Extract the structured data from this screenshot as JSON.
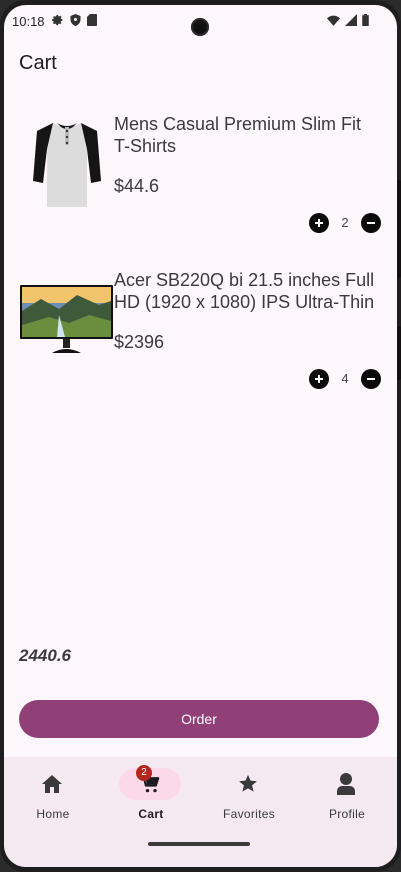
{
  "status_bar": {
    "time": "10:18"
  },
  "page": {
    "title": "Cart"
  },
  "cart": {
    "items": [
      {
        "name": "Mens Casual Premium Slim Fit T-Shirts",
        "price": "$44.6",
        "quantity": "2"
      },
      {
        "name": "Acer SB220Q bi 21.5 inches Full HD (1920 x 1080) IPS Ultra-Thin",
        "price": "$2396",
        "quantity": "4"
      }
    ],
    "total": "2440.6",
    "order_label": "Order"
  },
  "nav": {
    "items": [
      {
        "label": "Home",
        "icon": "home-icon"
      },
      {
        "label": "Cart",
        "icon": "cart-icon",
        "badge": "2",
        "active": true
      },
      {
        "label": "Favorites",
        "icon": "star-icon"
      },
      {
        "label": "Profile",
        "icon": "person-icon"
      }
    ]
  },
  "colors": {
    "accent": "#914077",
    "nav_bg": "#f5e9f1",
    "active_pill": "#fcd9ea",
    "badge": "#b3261e",
    "screen_bg": "#fdf7fc"
  }
}
